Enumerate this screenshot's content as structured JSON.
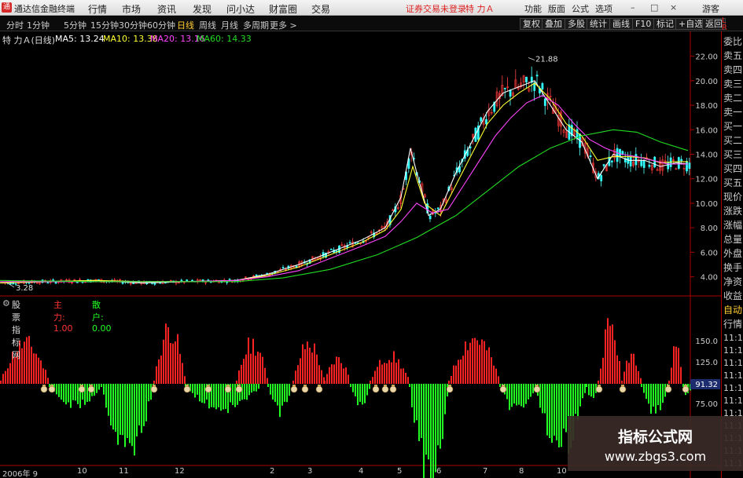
{
  "menubar": {
    "logo_glyph": "通",
    "app_name": "通达信金融终端",
    "items": [
      "行情",
      "市场",
      "资讯",
      "发现",
      "问小达",
      "财富圈",
      "交易"
    ],
    "notice": "证券交易未登录",
    "stock_name": "特 力Ａ",
    "right_items": [
      "功能",
      "版面",
      "公式",
      "选项"
    ],
    "guest": "游客",
    "window_buttons": [
      "–",
      "□",
      "×"
    ]
  },
  "toolbar": {
    "periods": [
      "分时",
      "1分钟",
      "5分钟",
      "15分钟",
      "30分钟",
      "60分钟",
      "日线",
      "周线",
      "月线",
      "多周期",
      "更多 >"
    ],
    "active_period": "日线",
    "buttons": [
      "复权",
      "叠加",
      "多股",
      "统计",
      "画线",
      "F10",
      "标记",
      "+自选",
      "返回"
    ]
  },
  "info": {
    "title": "特 力Ａ(日线)",
    "ma5": "MA5: 13.24",
    "ma10": "MA10: 13.38",
    "ma20": "MA20: 13.16",
    "ma60": "MA60: 14.33"
  },
  "colors": {
    "ma5": "#ffffff",
    "ma10": "#ffff33",
    "ma20": "#ff44ff",
    "ma60": "#22dd22",
    "up": "#ff2222",
    "down": "#22ff22",
    "frame": "#aa0000"
  },
  "price_axis": {
    "labels": [
      "22.00",
      "20.00",
      "18.00",
      "16.00",
      "14.00",
      "12.00",
      "10.00",
      "8.00",
      "6.00",
      "4.00"
    ],
    "high_mark": "21.88",
    "low_mark": "3.28"
  },
  "indicator": {
    "name": "股票指标网",
    "main_force": "主力: 1.00",
    "retail": "散户: 0.00",
    "axis_labels": [
      "150.0",
      "125.0",
      "75.00"
    ],
    "current_value": "91.32"
  },
  "right_panel": {
    "lr": [
      "L",
      "R"
    ],
    "items": [
      "委比",
      "卖五",
      "卖四",
      "卖三",
      "卖二",
      "卖一",
      "买一",
      "买二",
      "买三",
      "买四",
      "买五",
      "现价",
      "涨跌",
      "涨幅",
      "总量",
      "外盘",
      "换手",
      "净资",
      "收益"
    ],
    "lower_items": [
      "自动",
      "行情"
    ],
    "times": [
      "11:1",
      "11:1",
      "11:1",
      "11:1",
      "11:1",
      "11:1",
      "11:1",
      "11:1",
      "11:1",
      "11:1",
      "11:1"
    ]
  },
  "time_axis": [
    "2006年 9",
    "10",
    "11",
    "12",
    "2",
    "3",
    "4",
    "5",
    "6",
    "7",
    "8",
    "10"
  ],
  "watermark": {
    "line1": "指标公式网",
    "line2": "www.zbgs3.com"
  },
  "chart_data": {
    "type": "candlestick",
    "ma_series": [
      {
        "name": "MA5",
        "approx_path": [
          [
            0,
            3.5
          ],
          [
            60,
            3.6
          ],
          [
            120,
            3.7
          ],
          [
            180,
            3.5
          ],
          [
            240,
            3.6
          ],
          [
            300,
            3.7
          ],
          [
            340,
            4.2
          ],
          [
            380,
            5.0
          ],
          [
            420,
            6.0
          ],
          [
            460,
            7.0
          ],
          [
            490,
            8.0
          ],
          [
            510,
            10.5
          ],
          [
            522,
            14.5
          ],
          [
            530,
            12.5
          ],
          [
            545,
            9.0
          ],
          [
            560,
            9.5
          ],
          [
            580,
            12.5
          ],
          [
            600,
            15.0
          ],
          [
            620,
            17.5
          ],
          [
            640,
            19.0
          ],
          [
            660,
            19.5
          ],
          [
            680,
            20.0
          ],
          [
            700,
            18.0
          ],
          [
            720,
            16.0
          ],
          [
            740,
            15.0
          ],
          [
            760,
            12.0
          ],
          [
            780,
            14.0
          ],
          [
            800,
            13.5
          ],
          [
            820,
            13.5
          ],
          [
            840,
            13.0
          ],
          [
            860,
            13.3
          ],
          [
            875,
            13.2
          ]
        ]
      },
      {
        "name": "MA10",
        "approx_path": [
          [
            0,
            3.5
          ],
          [
            60,
            3.6
          ],
          [
            120,
            3.7
          ],
          [
            180,
            3.6
          ],
          [
            240,
            3.6
          ],
          [
            300,
            3.7
          ],
          [
            340,
            4.1
          ],
          [
            380,
            4.8
          ],
          [
            420,
            5.8
          ],
          [
            460,
            6.8
          ],
          [
            490,
            7.8
          ],
          [
            510,
            9.5
          ],
          [
            525,
            13.0
          ],
          [
            540,
            10.0
          ],
          [
            560,
            9.0
          ],
          [
            580,
            11.5
          ],
          [
            600,
            14.0
          ],
          [
            620,
            16.5
          ],
          [
            640,
            18.0
          ],
          [
            660,
            19.0
          ],
          [
            680,
            19.8
          ],
          [
            700,
            18.5
          ],
          [
            720,
            16.5
          ],
          [
            740,
            15.5
          ],
          [
            760,
            13.5
          ],
          [
            780,
            13.8
          ],
          [
            800,
            13.8
          ],
          [
            820,
            13.7
          ],
          [
            840,
            13.3
          ],
          [
            860,
            13.4
          ],
          [
            875,
            13.4
          ]
        ]
      },
      {
        "name": "MA20",
        "approx_path": [
          [
            0,
            3.6
          ],
          [
            120,
            3.6
          ],
          [
            240,
            3.6
          ],
          [
            300,
            3.7
          ],
          [
            340,
            4.0
          ],
          [
            380,
            4.5
          ],
          [
            420,
            5.5
          ],
          [
            460,
            6.5
          ],
          [
            490,
            7.3
          ],
          [
            510,
            8.5
          ],
          [
            530,
            10.0
          ],
          [
            550,
            9.2
          ],
          [
            570,
            9.5
          ],
          [
            590,
            11.5
          ],
          [
            610,
            13.5
          ],
          [
            630,
            15.5
          ],
          [
            650,
            17.0
          ],
          [
            670,
            18.2
          ],
          [
            690,
            18.8
          ],
          [
            710,
            18.0
          ],
          [
            730,
            16.5
          ],
          [
            750,
            15.2
          ],
          [
            770,
            14.5
          ],
          [
            790,
            14.0
          ],
          [
            810,
            13.8
          ],
          [
            830,
            13.5
          ],
          [
            850,
            13.2
          ],
          [
            875,
            13.2
          ]
        ]
      },
      {
        "name": "MA60",
        "approx_path": [
          [
            0,
            3.7
          ],
          [
            120,
            3.6
          ],
          [
            240,
            3.6
          ],
          [
            300,
            3.6
          ],
          [
            360,
            3.9
          ],
          [
            420,
            4.6
          ],
          [
            480,
            5.8
          ],
          [
            530,
            7.2
          ],
          [
            580,
            9.0
          ],
          [
            620,
            11.0
          ],
          [
            660,
            13.0
          ],
          [
            700,
            14.5
          ],
          [
            740,
            15.5
          ],
          [
            780,
            16.0
          ],
          [
            810,
            15.8
          ],
          [
            840,
            15.0
          ],
          [
            875,
            14.3
          ]
        ]
      }
    ],
    "high": 21.88,
    "low": 3.28,
    "ylim": [
      2.5,
      23.0
    ]
  }
}
